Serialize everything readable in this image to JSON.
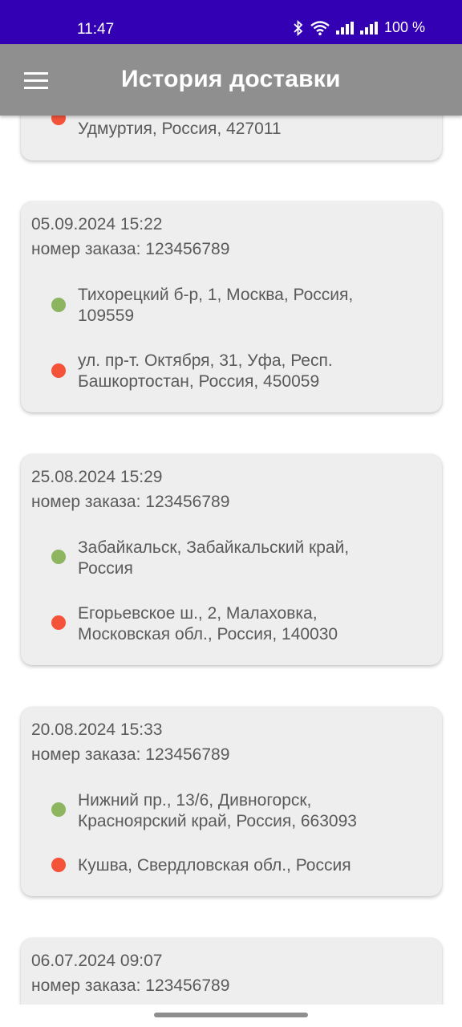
{
  "status_bar": {
    "time": "11:47",
    "battery": "100 %",
    "icons": [
      "bluetooth-icon",
      "wifi-icon",
      "signal-icon",
      "signal-icon"
    ]
  },
  "app_bar": {
    "title": "История доставки",
    "menu_icon": "hamburger-menu-icon"
  },
  "colors": {
    "status_bar": "#3300b3",
    "app_bar": "#8f8f8f",
    "card_bg": "#eeeeee",
    "origin_dot": "#8db560",
    "destination_dot": "#f4533a"
  },
  "partial_card": {
    "to_line2": "Удмуртия, Россия, 427011"
  },
  "orders": [
    {
      "date": "05.09.2024 15:22",
      "order": "номер заказа: 123456789",
      "from": [
        "Тихорецкий б-р, 1, Москва, Россия,",
        "109559"
      ],
      "to": [
        "ул. пр-т. Октября, 31, Уфа, Респ.",
        "Башкортостан, Россия, 450059"
      ]
    },
    {
      "date": "25.08.2024 15:29",
      "order": "номер заказа: 123456789",
      "from": [
        "Забайкальск, Забайкальский край,",
        "Россия"
      ],
      "to": [
        "Егорьевское ш., 2, Малаховка,",
        "Московская обл., Россия, 140030"
      ]
    },
    {
      "date": "20.08.2024 15:33",
      "order": "номер заказа: 123456789",
      "from": [
        "Нижний пр., 13/6, Дивногорск,",
        "Красноярский край, Россия, 663093"
      ],
      "to": [
        "Кушва, Свердловская обл., Россия"
      ]
    },
    {
      "date": "06.07.2024 09:07",
      "order": "номер заказа: 123456789"
    }
  ]
}
